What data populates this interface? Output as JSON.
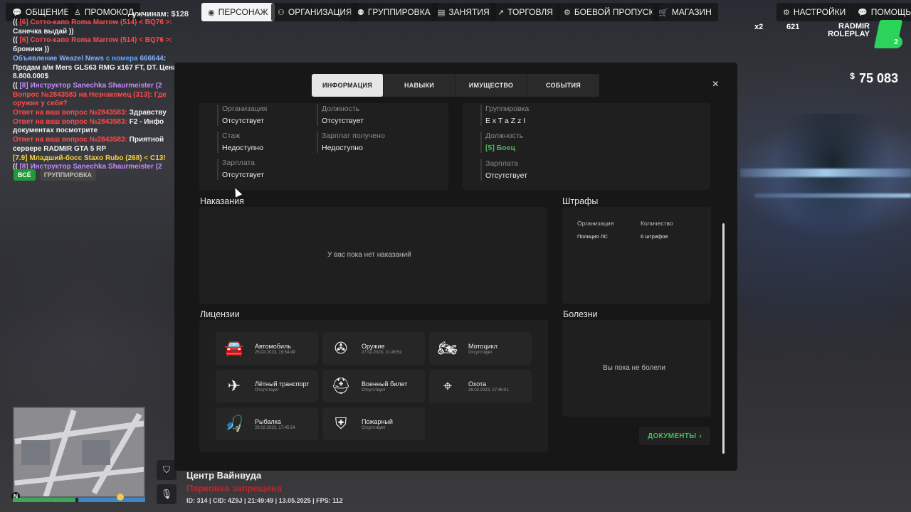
{
  "topbar": {
    "items": [
      {
        "label": "ОБЩЕНИЕ",
        "icon": "chat-icon"
      },
      {
        "label": "ПРОМОКОД",
        "icon": "person-icon"
      },
      {
        "label": "ПЕРСОНАЖ",
        "icon": "avatar-icon"
      },
      {
        "label": "ОРГАНИЗАЦИЯ",
        "icon": "org-icon"
      },
      {
        "label": "ГРУППИРОВКА",
        "icon": "group-icon"
      },
      {
        "label": "ЗАНЯТИЯ",
        "icon": "task-icon"
      },
      {
        "label": "ТОРГОВЛЯ",
        "icon": "chart-icon"
      },
      {
        "label": "БОЕВОЙ ПРОПУСК",
        "icon": "gear-icon"
      },
      {
        "label": "МАГАЗИН",
        "icon": "cart-icon"
      },
      {
        "label": "НАСТРОЙКИ",
        "icon": "settings-icon"
      },
      {
        "label": "ПОМОЩЬ",
        "icon": "help-icon"
      }
    ],
    "partial_label": "ужчинам: $128"
  },
  "chat": {
    "lines": [
      {
        "parts": [
          {
            "t": "(( ",
            "c": "w"
          },
          {
            "t": "[6] Сотто-капо Roma Marrow (514) < BQ76 >: ",
            "c": "r"
          },
          {
            "t": "Санечка выдай ))",
            "c": "w"
          }
        ]
      },
      {
        "parts": [
          {
            "t": "(( ",
            "c": "w"
          },
          {
            "t": "[6] Сотто-капо Roma Marrow (514) < BQ76 >: ",
            "c": "r"
          },
          {
            "t": "броники ))",
            "c": "w"
          }
        ]
      },
      {
        "parts": [
          {
            "t": "Объявление Weazel News ",
            "c": "b"
          },
          {
            "t": "с номера ",
            "c": "c"
          },
          {
            "t": "666644",
            "c": "b"
          },
          {
            "t": ": Продам а/м Mers GLS63 RMG x167 FT, DT. Цена: 8.800.000$",
            "c": "w"
          }
        ]
      },
      {
        "parts": [
          {
            "t": "(( ",
            "c": "w"
          },
          {
            "t": "[8] Инструктор Sanechka Shaurmeister (2",
            "c": "p"
          }
        ]
      },
      {
        "parts": [
          {
            "t": "Вопрос №2843583 на Незнакомец (313): Где оружие у себя?",
            "c": "r"
          }
        ]
      },
      {
        "parts": [
          {
            "t": "Ответ на ваш вопрос №2843583: ",
            "c": "r"
          },
          {
            "t": "Здравству",
            "c": "w"
          }
        ]
      },
      {
        "parts": [
          {
            "t": "Ответ на ваш вопрос №2843583: ",
            "c": "r"
          },
          {
            "t": "F2 - Инфо документах посмотрите",
            "c": "w"
          }
        ]
      },
      {
        "parts": [
          {
            "t": "Ответ на ваш вопрос №2843583: ",
            "c": "r"
          },
          {
            "t": "Приятной сервере RADMIR GTA 5 RP",
            "c": "w"
          }
        ]
      },
      {
        "parts": [
          {
            "t": "[7.9] Младший-босс Staxo Rubo (268) < C13!",
            "c": "y"
          }
        ]
      },
      {
        "parts": [
          {
            "t": "(( ",
            "c": "w"
          },
          {
            "t": "[8] Инструктор Sanechka Shaurmeister (2",
            "c": "p"
          }
        ]
      }
    ],
    "tab_all": "ВСЁ",
    "tab_group": "ГРУППИРОВКА"
  },
  "hud": {
    "chip_x2": "x2",
    "chip_621": "621",
    "logo_line1": "RADMIR",
    "logo_line2": "ROLEPLAY",
    "logo_badge": "2",
    "money_sign": "$",
    "money_value": "75 083"
  },
  "bottom": {
    "location": "Центр Вайнвуда",
    "zone": "Парковка запрещена",
    "info": "ID: 314 | CID: 4Z9J | 21:49:49 | 13.05.2025 | FPS: 112",
    "compass": "N"
  },
  "modal": {
    "tabs": [
      {
        "label": "ИНФОРМАЦИЯ",
        "active": true
      },
      {
        "label": "НАВЫКИ",
        "active": false
      },
      {
        "label": "ИМУЩЕСТВО",
        "active": false
      },
      {
        "label": "СОБЫТИЯ",
        "active": false
      }
    ],
    "close": "×",
    "org": {
      "f1_label": "Организация",
      "f1_value": "Отсутствует",
      "f2_label": "Должность",
      "f2_value": "Отсутствует",
      "f3_label": "Стаж",
      "f3_value": "Недоступно",
      "f4_label": "Зарплат получено",
      "f4_value": "Недоступно",
      "f5_label": "Зарплата",
      "f5_value": "Отсутствует"
    },
    "gang": {
      "f1_label": "Группировка",
      "f1_value": "E x T a Z z I",
      "f2_label": "Должность",
      "f2_value": "[5] Боец",
      "f3_label": "Зарплата",
      "f3_value": "Отсутствует"
    },
    "punishments": {
      "title": "Наказания",
      "empty": "У вас пока нет наказаний"
    },
    "fines": {
      "title": "Штрафы",
      "col1": "Организация",
      "col2": "Количество",
      "rows": [
        {
          "org": "Полиция ЛС",
          "count": "6 штрафов"
        }
      ]
    },
    "licenses": {
      "title": "Лицензии",
      "items": [
        {
          "name": "Автомобиль",
          "sub": "25.02.2023, 19:54:49",
          "icon": "car-icon",
          "glyph": "🚘"
        },
        {
          "name": "Оружие",
          "sub": "27.02.2023, 21:45:52",
          "icon": "rifle-icon",
          "glyph": "✇"
        },
        {
          "name": "Мотоцикл",
          "sub": "Отсутствует",
          "icon": "motorcycle-icon",
          "glyph": "🏍"
        },
        {
          "name": "Лётный транспорт",
          "sub": "Отсутствует",
          "icon": "plane-icon",
          "glyph": "✈"
        },
        {
          "name": "Военный билет",
          "sub": "Отсутствует",
          "icon": "helmet-icon",
          "glyph": "⛑"
        },
        {
          "name": "Охота",
          "sub": "28.02.2023, 17:46:01",
          "icon": "crosshair-icon",
          "glyph": "⌖"
        },
        {
          "name": "Рыбалка",
          "sub": "28.02.2023, 17:45:54",
          "icon": "fishing-icon",
          "glyph": "🎣"
        },
        {
          "name": "Пожарный",
          "sub": "Отсутствует",
          "icon": "fire-shield-icon",
          "glyph": "⛨"
        }
      ]
    },
    "diseases": {
      "title": "Болезни",
      "empty": "Вы пока не болели"
    },
    "docs_button": "ДОКУМЕНТЫ",
    "docs_chevron": "›"
  }
}
